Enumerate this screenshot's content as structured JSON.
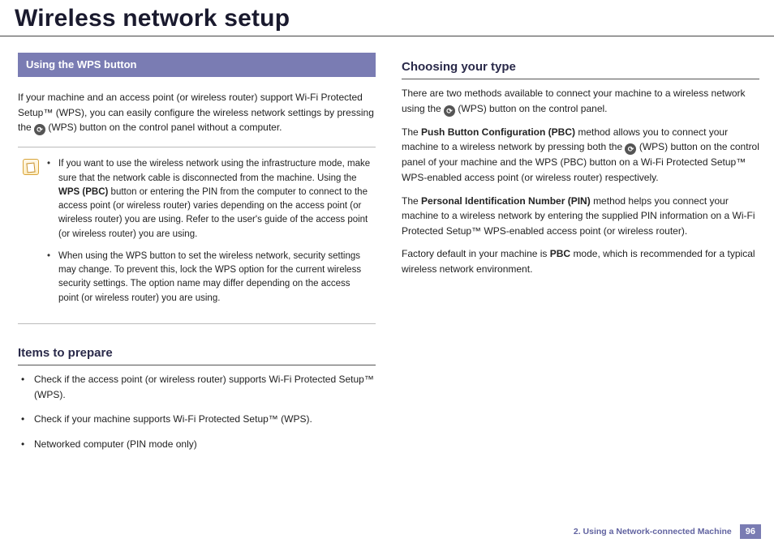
{
  "title": "Wireless network setup",
  "left": {
    "section_bar": "Using the WPS button",
    "intro_a": "If your machine and an access point (or wireless router) support Wi-Fi Protected Setup™ (WPS), you can easily configure the wireless network settings by pressing the ",
    "intro_b": " (WPS) button on the control panel without a computer.",
    "note1_a": "If you want to use the wireless network using the infrastructure mode, make sure that the network cable is disconnected from the machine. Using the ",
    "note1_bold": "WPS (PBC)",
    "note1_b": " button or entering the PIN from the computer to connect to the access point (or wireless router) varies depending on the access point (or wireless router) you are using. Refer to the user's guide of the access point (or wireless router) you are using.",
    "note2": "When using the WPS button to set the wireless network, security settings may change. To prevent this, lock the WPS option for the current wireless security settings. The option name may differ depending on the access point (or wireless router) you are using.",
    "subhead": "Items to prepare",
    "items": [
      "Check if the access point (or wireless router) supports Wi-Fi Protected Setup™ (WPS).",
      "Check if your machine supports Wi-Fi Protected Setup™ (WPS).",
      "Networked computer (PIN mode only)"
    ]
  },
  "right": {
    "subhead": "Choosing your type",
    "p1_a": "There are two methods available to connect your machine to a wireless network using the ",
    "p1_b": " (WPS) button on the control panel.",
    "p2_a": "The ",
    "p2_bold": "Push Button Configuration (PBC)",
    "p2_b": " method allows you to connect your machine to a wireless network by pressing both the ",
    "p2_c": " (WPS) button on the control panel of your machine and the WPS (PBC) button on a Wi-Fi Protected Setup™ WPS-enabled access point (or wireless router) respectively.",
    "p3_a": "The ",
    "p3_bold": "Personal Identification Number (PIN)",
    "p3_b": " method helps you connect your machine to a wireless network by entering the supplied PIN information on a Wi-Fi Protected Setup™ WPS-enabled access point (or wireless router).",
    "p4_a": "Factory default in your machine is ",
    "p4_bold": "PBC",
    "p4_b": " mode, which is recommended for a typical wireless network environment."
  },
  "footer": {
    "chapter": "2.  Using a Network-connected Machine",
    "page": "96"
  },
  "icon_glyph": "⟳"
}
